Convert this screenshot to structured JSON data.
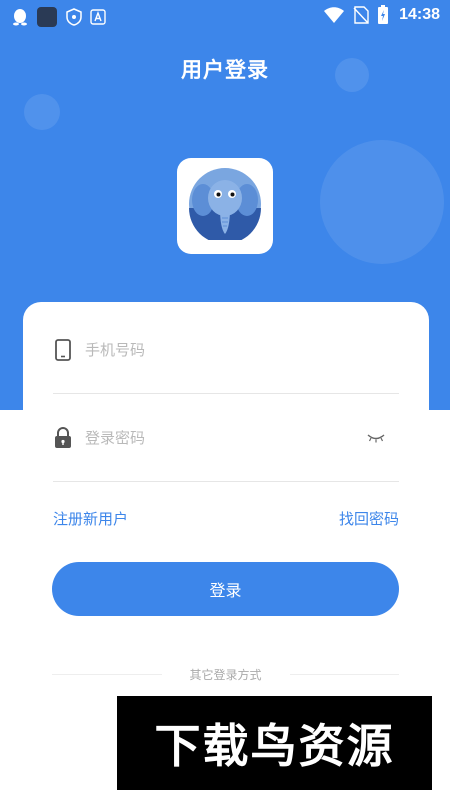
{
  "status_bar": {
    "time": "14:38",
    "left_icons": [
      "qq-penguin-icon",
      "app-square-icon",
      "shield-icon",
      "font-a-icon"
    ],
    "right_icons": [
      "wifi-icon",
      "no-sim-icon",
      "battery-charging-icon"
    ]
  },
  "header": {
    "title": "用户登录"
  },
  "logo": {
    "icon": "elephant-logo-icon"
  },
  "form": {
    "phone_placeholder": "手机号码",
    "password_placeholder": "登录密码",
    "register_link": "注册新用户",
    "forgot_link": "找回密码",
    "login_button": "登录",
    "other_methods": "其它登录方式"
  },
  "watermark": {
    "text": "下载鸟资源"
  },
  "colors": {
    "primary": "#3d86ea",
    "background": "#ffffff",
    "placeholder": "#b9b9b9",
    "divider": "#e6e6e6"
  }
}
